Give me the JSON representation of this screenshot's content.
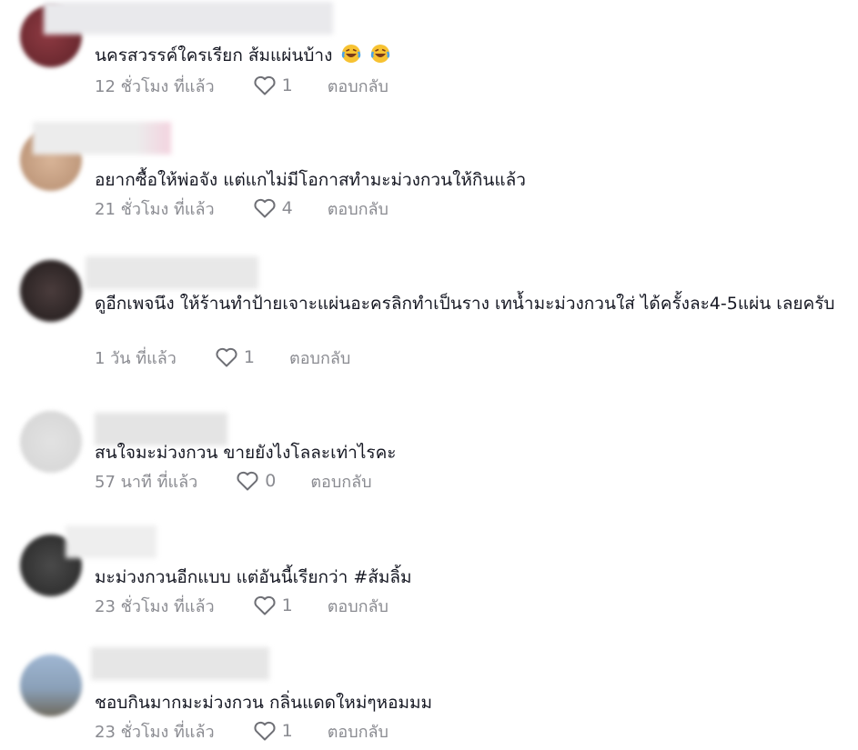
{
  "comments": [
    {
      "text": "นครสวรรค์ใครเรียก ส้มแผ่นบ้าง",
      "emojis": [
        "laughing-crying-emoji",
        "laughing-crying-emoji"
      ],
      "time": "12 ชั่วโมง ที่แล้ว",
      "likes": "1",
      "reply": "ตอบกลับ",
      "avatar_color": "#7a2f35"
    },
    {
      "text": "อยากซื้อให้พ่อจัง แต่แกไม่มีโอกาสทำมะม่วงกวนให้กินแล้ว",
      "emojis": [],
      "time": "21 ชั่วโมง ที่แล้ว",
      "likes": "4",
      "reply": "ตอบกลับ",
      "avatar_color": "#c9a68a"
    },
    {
      "text": "ดูอีกเพจนึง ให้ร้านทำป้ายเจาะแผ่นอะครลิกทำเป็นราง เทน้ำมะม่วงกวนใส่ ได้ครั้งละ4-5แผ่น เลยครับ",
      "emojis": [],
      "time": "1 วัน ที่แล้ว",
      "likes": "1",
      "reply": "ตอบกลับ",
      "avatar_color": "#3a3030"
    },
    {
      "text": "สนใจมะม่วงกวน ขายยังไงโลละเท่าไรคะ",
      "emojis": [],
      "time": "57 นาที ที่แล้ว",
      "likes": "0",
      "reply": "ตอบกลับ",
      "avatar_color": "#dcdcdc"
    },
    {
      "text": "มะม่วงกวนอีกแบบ แต่อันนี้เรียกว่า #ส้มลิ้ม",
      "emojis": [],
      "time": "23 ชั่วโมง ที่แล้ว",
      "likes": "1",
      "reply": "ตอบกลับ",
      "avatar_color": "#3c3c3c"
    },
    {
      "text": "ชอบกินมากมะม่วงกวน กลิ่นแดดใหม่ๆหอมมม",
      "emojis": [],
      "time": "23 ชั่วโมง ที่แล้ว",
      "likes": "1",
      "reply": "ตอบกลับ",
      "avatar_color": "#8fa4bd"
    }
  ],
  "colors": {
    "text": "#161823",
    "meta": "#8a8b91",
    "heart_stroke": "#6e6f75"
  }
}
